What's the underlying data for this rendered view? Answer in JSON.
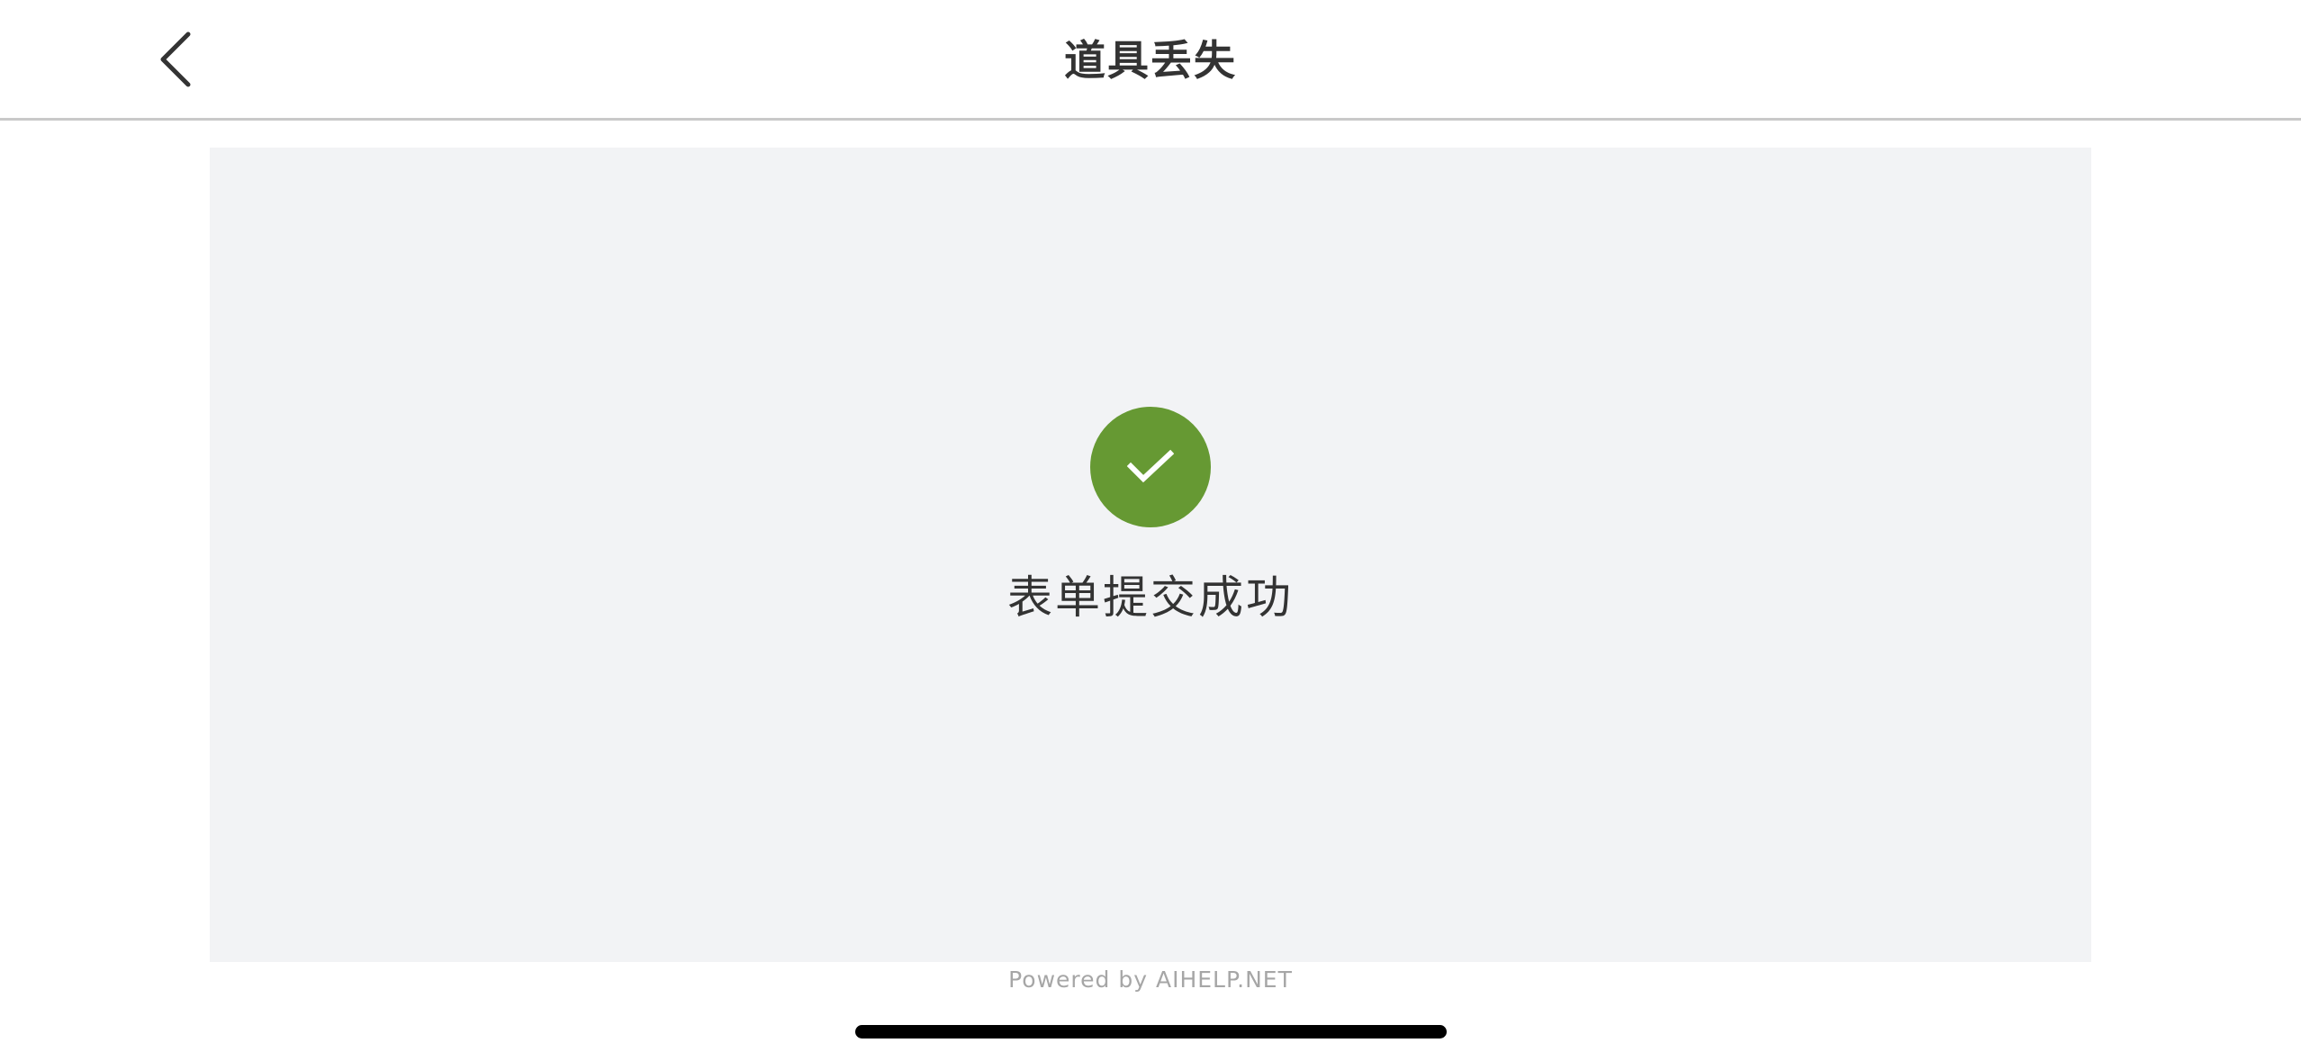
{
  "header": {
    "title": "道具丢失",
    "back_icon": "chevron-left-icon"
  },
  "content": {
    "status_icon": "check-circle-icon",
    "status_color": "#669933",
    "message": "表单提交成功"
  },
  "footer": {
    "powered_by": "Powered by AIHELP.NET"
  }
}
